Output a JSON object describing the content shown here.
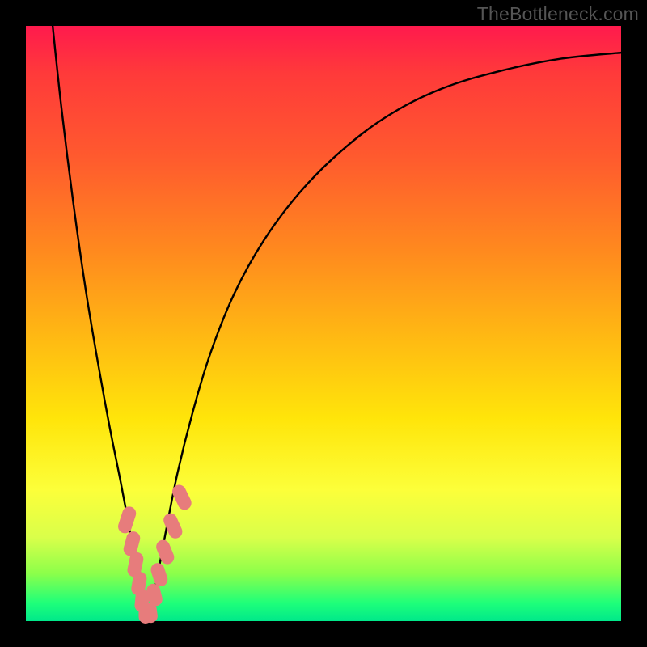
{
  "watermark": "TheBottleneck.com",
  "chart_data": {
    "type": "line",
    "title": "",
    "xlabel": "",
    "ylabel": "",
    "xlim": [
      0,
      100
    ],
    "ylim": [
      0,
      100
    ],
    "note": "No numeric axis labels are present in the image; x and y are normalized 0–100 based on plot-area pixel position.",
    "series": [
      {
        "name": "bottleneck-curve",
        "color": "#000000",
        "x": [
          4.5,
          6,
          8,
          10,
          12,
          14,
          16,
          17.5,
          18.5,
          19.3,
          20,
          20.5,
          21,
          22,
          23.5,
          25.5,
          28,
          31,
          35,
          40,
          46,
          53,
          61,
          70,
          80,
          90,
          100
        ],
        "y": [
          100,
          86,
          70,
          56,
          44,
          33,
          23,
          15,
          9,
          4.5,
          1.5,
          0,
          2,
          7,
          15,
          25,
          35,
          45,
          55,
          64,
          72,
          79,
          85,
          89.5,
          92.5,
          94.5,
          95.5
        ]
      }
    ],
    "markers": [
      {
        "name": "beads-left",
        "shape": "rounded-rect",
        "color": "#e77c7c",
        "points": [
          {
            "x": 17.0,
            "y": 17.0,
            "w": 2.3,
            "h": 4.6,
            "rot": 18
          },
          {
            "x": 17.8,
            "y": 13.0,
            "w": 2.3,
            "h": 4.2,
            "rot": 15
          },
          {
            "x": 18.4,
            "y": 9.5,
            "w": 2.3,
            "h": 4.2,
            "rot": 12
          },
          {
            "x": 19.0,
            "y": 6.3,
            "w": 2.3,
            "h": 4.0,
            "rot": 10
          },
          {
            "x": 19.5,
            "y": 3.4,
            "w": 2.3,
            "h": 3.8,
            "rot": 6
          },
          {
            "x": 20.1,
            "y": 1.2,
            "w": 2.3,
            "h": 3.2,
            "rot": 0
          }
        ]
      },
      {
        "name": "beads-right",
        "shape": "rounded-rect",
        "color": "#e77c7c",
        "points": [
          {
            "x": 20.9,
            "y": 1.4,
            "w": 2.3,
            "h": 3.4,
            "rot": -8
          },
          {
            "x": 21.6,
            "y": 4.4,
            "w": 2.3,
            "h": 3.8,
            "rot": -14
          },
          {
            "x": 22.4,
            "y": 7.8,
            "w": 2.3,
            "h": 4.0,
            "rot": -18
          },
          {
            "x": 23.4,
            "y": 11.6,
            "w": 2.3,
            "h": 4.2,
            "rot": -22
          },
          {
            "x": 24.7,
            "y": 16.0,
            "w": 2.3,
            "h": 4.4,
            "rot": -24
          },
          {
            "x": 26.2,
            "y": 20.8,
            "w": 2.3,
            "h": 4.4,
            "rot": -26
          }
        ]
      }
    ]
  }
}
